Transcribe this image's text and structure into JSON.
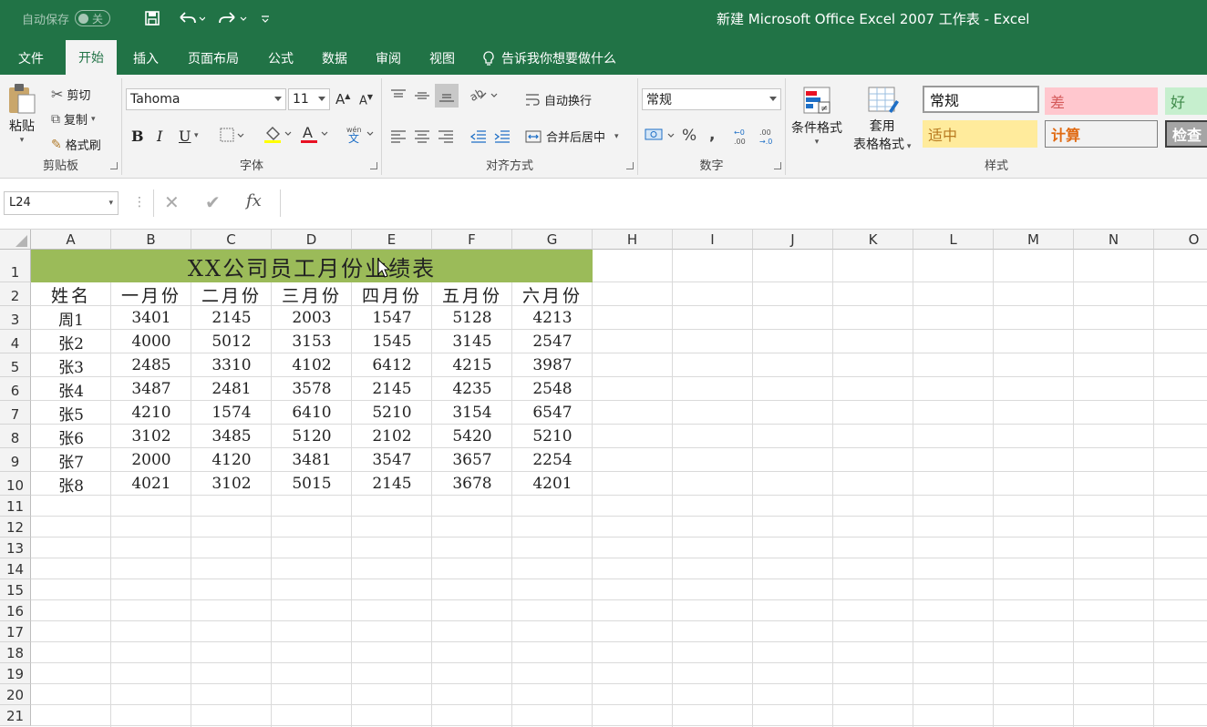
{
  "titlebar": {
    "autosave_label": "自动保存",
    "autosave_state": "关",
    "title": "新建 Microsoft Office Excel 2007 工作表  -  Excel"
  },
  "tabs": [
    "文件",
    "开始",
    "插入",
    "页面布局",
    "公式",
    "数据",
    "审阅",
    "视图"
  ],
  "tell_me": "告诉我你想要做什么",
  "ribbon": {
    "clipboard": {
      "paste": "粘贴",
      "cut": "剪切",
      "copy": "复制",
      "format_painter": "格式刷",
      "label": "剪贴板"
    },
    "font": {
      "name": "Tahoma",
      "size": "11",
      "label": "字体",
      "bold": "B",
      "italic": "I",
      "underline": "U",
      "font_color": "#e81123"
    },
    "alignment": {
      "wrap": "自动换行",
      "merge": "合并后居中",
      "label": "对齐方式"
    },
    "number": {
      "format": "常规",
      "label": "数字"
    },
    "styles": {
      "conditional": "条件格式",
      "table_line1": "套用",
      "table_line2": "表格格式",
      "cells": [
        "常规",
        "差",
        "好",
        "适中",
        "计算",
        "检查"
      ],
      "label": "样式"
    }
  },
  "formula_bar": {
    "name_box": "L24",
    "fx": "fx",
    "value": ""
  },
  "columns": [
    "A",
    "B",
    "C",
    "D",
    "E",
    "F",
    "G",
    "H",
    "I",
    "J",
    "K",
    "L",
    "M",
    "N",
    "O"
  ],
  "rows": [
    "1",
    "2",
    "3",
    "4",
    "5",
    "6",
    "7",
    "8",
    "9",
    "10",
    "11",
    "12",
    "13",
    "14",
    "15",
    "16",
    "17",
    "18",
    "19",
    "20",
    "21"
  ],
  "sheet": {
    "title": "XX公司员工月份业绩表",
    "title_fill": "#9bbb59",
    "headers": [
      "姓名",
      "一月份",
      "二月份",
      "三月份",
      "四月份",
      "五月份",
      "六月份"
    ],
    "data": [
      [
        "周1",
        "3401",
        "2145",
        "2003",
        "1547",
        "5128",
        "4213"
      ],
      [
        "张2",
        "4000",
        "5012",
        "3153",
        "1545",
        "3145",
        "2547"
      ],
      [
        "张3",
        "2485",
        "3310",
        "4102",
        "6412",
        "4215",
        "3987"
      ],
      [
        "张4",
        "3487",
        "2481",
        "3578",
        "2145",
        "4235",
        "2548"
      ],
      [
        "张5",
        "4210",
        "1574",
        "6410",
        "5210",
        "3154",
        "6547"
      ],
      [
        "张6",
        "3102",
        "3485",
        "5120",
        "2102",
        "5420",
        "5210"
      ],
      [
        "张7",
        "2000",
        "4120",
        "3481",
        "3547",
        "3657",
        "2254"
      ],
      [
        "张8",
        "4021",
        "3102",
        "5015",
        "2145",
        "3678",
        "4201"
      ]
    ]
  }
}
